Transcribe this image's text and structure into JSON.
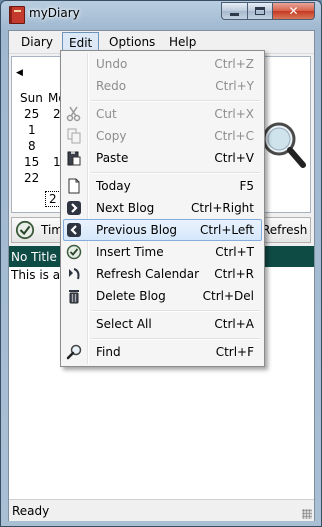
{
  "window": {
    "title": "myDiary"
  },
  "menubar": [
    "Diary",
    "Edit",
    "Options",
    "Help"
  ],
  "calendar": {
    "day_headers": [
      "Sun",
      "Mo"
    ],
    "visible_days": [
      "25",
      "2",
      "1",
      "8",
      "15",
      "1",
      "22",
      "2"
    ]
  },
  "toolbar": {
    "time_label": "Time",
    "refresh_label": "Refresh"
  },
  "entry": {
    "title": "No Title",
    "body_text": "This is a So"
  },
  "status": {
    "text": "Ready"
  },
  "edit_menu": {
    "items": [
      {
        "label": "Undo",
        "shortcut": "Ctrl+Z",
        "enabled": false,
        "icon": "none"
      },
      {
        "label": "Redo",
        "shortcut": "Ctrl+Y",
        "enabled": false,
        "icon": "none"
      },
      {
        "label": "Cut",
        "shortcut": "Ctrl+X",
        "enabled": false,
        "icon": "scissors-icon"
      },
      {
        "label": "Copy",
        "shortcut": "Ctrl+C",
        "enabled": false,
        "icon": "copy-icon"
      },
      {
        "label": "Paste",
        "shortcut": "Ctrl+V",
        "enabled": true,
        "icon": "paste-icon"
      },
      {
        "label": "Today",
        "shortcut": "F5",
        "enabled": true,
        "icon": "page-icon"
      },
      {
        "label": "Next Blog",
        "shortcut": "Ctrl+Right",
        "enabled": true,
        "icon": "next-arrow-icon"
      },
      {
        "label": "Previous Blog",
        "shortcut": "Ctrl+Left",
        "enabled": true,
        "icon": "previous-arrow-icon",
        "highlighted": true
      },
      {
        "label": "Insert Time",
        "shortcut": "Ctrl+T",
        "enabled": true,
        "icon": "clock-icon"
      },
      {
        "label": "Refresh Calendar",
        "shortcut": "Ctrl+R",
        "enabled": true,
        "icon": "refresh-icon"
      },
      {
        "label": "Delete Blog",
        "shortcut": "Ctrl+Del",
        "enabled": true,
        "icon": "trash-icon"
      },
      {
        "label": "Select All",
        "shortcut": "Ctrl+A",
        "enabled": true,
        "icon": "none"
      },
      {
        "label": "Find",
        "shortcut": "Ctrl+F",
        "enabled": true,
        "icon": "magnifier-icon"
      }
    ]
  },
  "colors": {
    "entry_header_bg": "#0f4b45",
    "menu_highlight": "#d5e7fb",
    "close_button": "#c53a22"
  }
}
